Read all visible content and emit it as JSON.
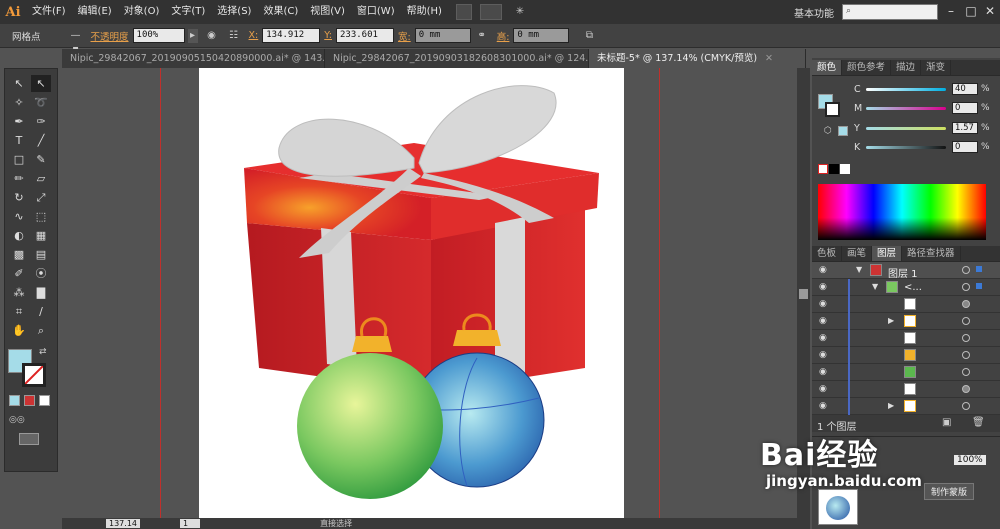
{
  "app": {
    "logo": "Ai",
    "workspace": "基本功能",
    "search_placeholder": ""
  },
  "menus": [
    "文件(F)",
    "编辑(E)",
    "对象(O)",
    "文字(T)",
    "选择(S)",
    "效果(C)",
    "视图(V)",
    "窗口(W)",
    "帮助(H)"
  ],
  "control": {
    "selection_label": "网格点",
    "opacity_label": "不透明度",
    "opacity_value": "100%",
    "x_label": "X:",
    "x_value": "134.912",
    "y_label": "Y:",
    "y_value": "233.601",
    "w_label": "宽:",
    "w_value": "0 mm",
    "h_label": "高:",
    "h_value": "0 mm"
  },
  "tabs": [
    {
      "label": "Nipic_29842067_20190905150420890000.ai* @ 143...",
      "active": false
    },
    {
      "label": "Nipic_29842067_20190903182608301000.ai* @ 124...",
      "active": false
    },
    {
      "label": "未标题-5* @ 137.14% (CMYK/预览)",
      "active": true
    }
  ],
  "color_panel": {
    "tabs": [
      "颜色",
      "颜色参考",
      "描边",
      "渐变"
    ],
    "active_tab": "颜色",
    "channels": [
      {
        "name": "C",
        "value": "40",
        "color": "#00aee0"
      },
      {
        "name": "M",
        "value": "0",
        "color": "#d8008c"
      },
      {
        "name": "Y",
        "value": "1.57",
        "color": "#e6d000"
      },
      {
        "name": "K",
        "value": "0",
        "color": "#222222"
      }
    ],
    "percent": "%"
  },
  "layers_panel": {
    "tabs": [
      "色板",
      "画笔",
      "图层",
      "路径查找器"
    ],
    "active_tab": "图层",
    "layer_name": "图层 1",
    "group_name": "<...",
    "footer": "1 个图层",
    "make_mask": "制作蒙版"
  },
  "transparency_value": "100%",
  "status": {
    "zoom": "137.14",
    "page": "1",
    "tool": "直接选择"
  },
  "watermark": {
    "brand": "Bai经验",
    "url": "jingyan.baidu.com"
  },
  "fill_color": "#a5dce8"
}
